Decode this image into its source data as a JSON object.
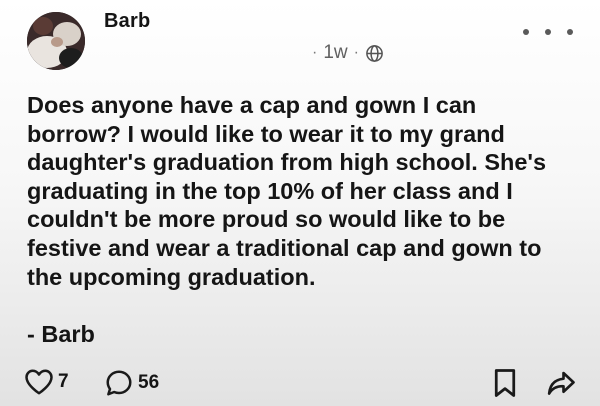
{
  "post": {
    "author": "Barb",
    "time": "1w",
    "separator": "·",
    "body_lines": [
      "Does anyone have a cap and gown I can",
      "borrow? I would like to wear it to my grand",
      "daughter's graduation from high school. She's",
      "graduating in the top 10% of her class and I",
      "couldn't be more proud so would like to be",
      "festive and wear a traditional cap and gown to",
      "the upcoming graduation."
    ],
    "signature": "- Barb",
    "likes": "7",
    "comments": "56"
  },
  "icons": {
    "avatar": "avatar-photo",
    "audience": "globe-icon",
    "menu": "more-options-icon",
    "like": "heart-icon",
    "comment": "comment-bubble-icon",
    "save": "bookmark-icon",
    "share": "share-arrow-icon"
  }
}
